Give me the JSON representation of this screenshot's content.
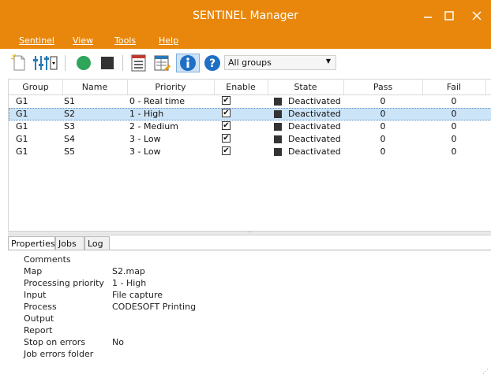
{
  "window": {
    "title": "SENTINEL Manager"
  },
  "menu": [
    "Sentinel",
    "View",
    "Tools",
    "Help"
  ],
  "toolbar": {
    "group_select": "All groups"
  },
  "table": {
    "headers": [
      "Group",
      "Name",
      "Priority",
      "Enable",
      "State",
      "Pass",
      "Fail"
    ],
    "rows": [
      {
        "group": "G1",
        "name": "S1",
        "priority": "0 - Real time",
        "enabled": "✔",
        "state": "Deactivated",
        "pass": "0",
        "fail": "0"
      },
      {
        "group": "G1",
        "name": "S2",
        "priority": "1 - High",
        "enabled": "✔",
        "state": "Deactivated",
        "pass": "0",
        "fail": "0"
      },
      {
        "group": "G1",
        "name": "S3",
        "priority": "2 - Medium",
        "enabled": "✔",
        "state": "Deactivated",
        "pass": "0",
        "fail": "0"
      },
      {
        "group": "G1",
        "name": "S4",
        "priority": "3 - Low",
        "enabled": "✔",
        "state": "Deactivated",
        "pass": "0",
        "fail": "0"
      },
      {
        "group": "G1",
        "name": "S5",
        "priority": "3 - Low",
        "enabled": "✔",
        "state": "Deactivated",
        "pass": "0",
        "fail": "0"
      }
    ]
  },
  "bottom_tabs": [
    "Properties",
    "Jobs",
    "Log"
  ],
  "properties": [
    {
      "label": "Comments",
      "value": ""
    },
    {
      "label": "Map",
      "value": "S2.map"
    },
    {
      "label": "Processing priority",
      "value": "1 - High"
    },
    {
      "label": "Input",
      "value": "File capture"
    },
    {
      "label": "Process",
      "value": "CODESOFT Printing"
    },
    {
      "label": "Output",
      "value": ""
    },
    {
      "label": "Report",
      "value": ""
    },
    {
      "label": "Stop on errors",
      "value": "No"
    },
    {
      "label": "Job errors folder",
      "value": ""
    }
  ],
  "colors": {
    "accent": "#e8870c",
    "selection": "#cce4f7"
  }
}
